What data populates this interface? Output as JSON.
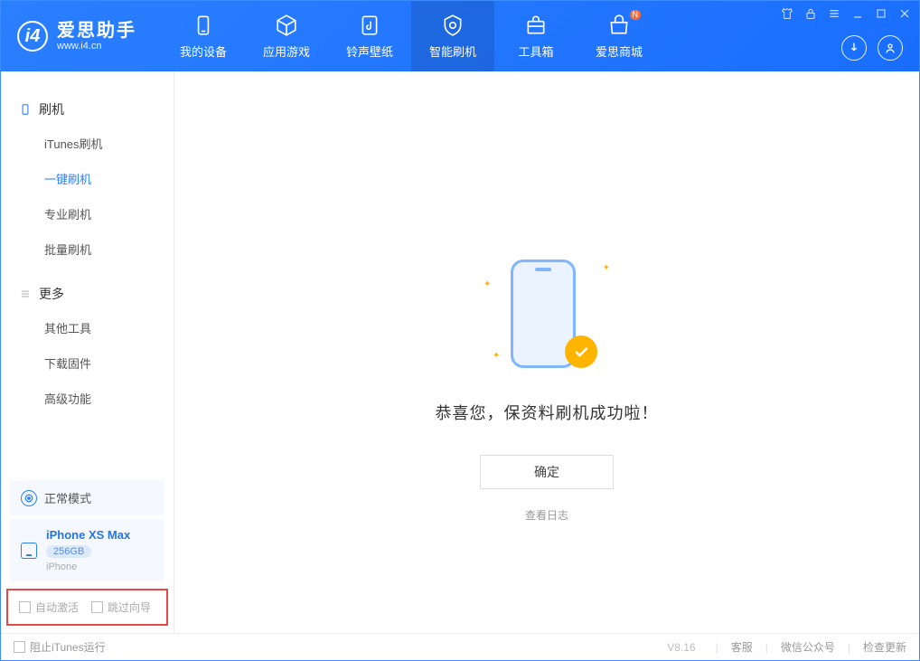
{
  "app": {
    "logo_title": "爱思助手",
    "logo_sub": "www.i4.cn"
  },
  "nav": {
    "tabs": [
      {
        "label": "我的设备"
      },
      {
        "label": "应用游戏"
      },
      {
        "label": "铃声壁纸"
      },
      {
        "label": "智能刷机"
      },
      {
        "label": "工具箱"
      },
      {
        "label": "爱思商城"
      }
    ]
  },
  "sidebar": {
    "group1_title": "刷机",
    "group1_items": [
      "iTunes刷机",
      "一键刷机",
      "专业刷机",
      "批量刷机"
    ],
    "group2_title": "更多",
    "group2_items": [
      "其他工具",
      "下载固件",
      "高级功能"
    ],
    "mode_label": "正常模式",
    "device_name": "iPhone XS Max",
    "device_capacity": "256GB",
    "device_type": "iPhone",
    "chk_auto_activate": "自动激活",
    "chk_skip_guide": "跳过向导"
  },
  "main": {
    "success_text": "恭喜您，保资料刷机成功啦！",
    "ok_button": "确定",
    "view_log": "查看日志"
  },
  "footer": {
    "block_itunes": "阻止iTunes运行",
    "version": "V8.16",
    "link_support": "客服",
    "link_wechat": "微信公众号",
    "link_update": "检查更新"
  }
}
